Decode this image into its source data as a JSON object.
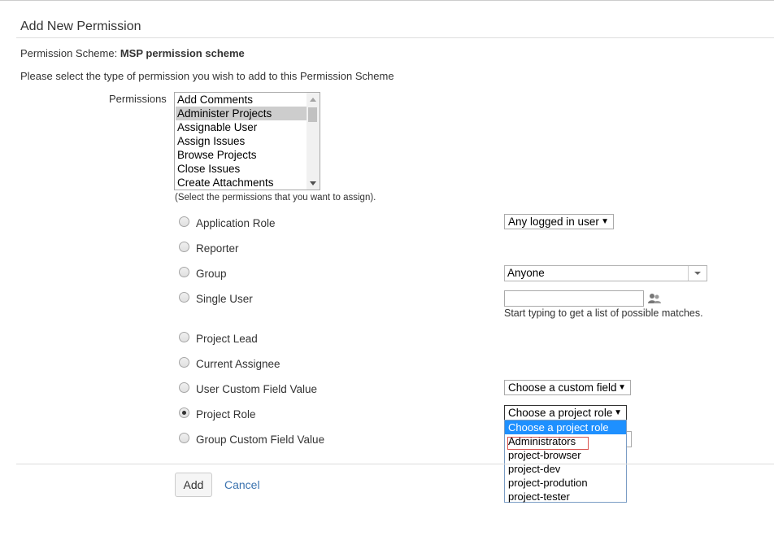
{
  "page": {
    "title": "Add New Permission",
    "scheme_label": "Permission Scheme:",
    "scheme_name": "MSP permission scheme",
    "instruction": "Please select the type of permission you wish to add to this Permission Scheme"
  },
  "permissions": {
    "label": "Permissions",
    "items": [
      "Add Comments",
      "Administer Projects",
      "Assignable User",
      "Assign Issues",
      "Browse Projects",
      "Close Issues",
      "Create Attachments"
    ],
    "selected": "Administer Projects",
    "hint": "(Select the permissions that you want to assign)."
  },
  "options": {
    "application_role": {
      "label": "Application Role",
      "value": "Any logged in user"
    },
    "reporter": {
      "label": "Reporter"
    },
    "group": {
      "label": "Group",
      "value": "Anyone"
    },
    "single_user": {
      "label": "Single User",
      "value": "",
      "hint": "Start typing to get a list of possible matches."
    },
    "project_lead": {
      "label": "Project Lead"
    },
    "current_assignee": {
      "label": "Current Assignee"
    },
    "user_custom_field": {
      "label": "User Custom Field Value",
      "value": "Choose a custom field"
    },
    "project_role": {
      "label": "Project Role",
      "value": "Choose a project role",
      "checked": true,
      "dropdown_options": [
        "Choose a project role",
        "Administrators",
        "project-browser",
        "project-dev",
        "project-prodution",
        "project-tester"
      ],
      "highlighted": "Choose a project role"
    },
    "group_custom_field": {
      "label": "Group Custom Field Value"
    }
  },
  "actions": {
    "add_label": "Add",
    "cancel_label": "Cancel"
  },
  "colors": {
    "link": "#3b73af",
    "highlight": "#1e90ff",
    "annotation": "#d9534f"
  }
}
